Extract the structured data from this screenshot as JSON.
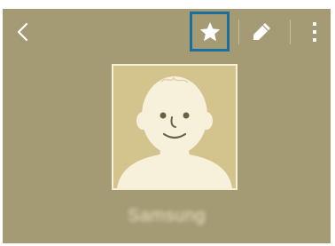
{
  "toolbar": {
    "back_icon": "chevron-left-icon",
    "favorite_icon": "star-icon",
    "edit_icon": "pencil-icon",
    "more_icon": "more-vertical-icon",
    "highlight_color": "#1a6f9e"
  },
  "contact": {
    "photo_icon": "default-avatar-icon",
    "name": "Samsung"
  },
  "colors": {
    "background": "#a49a73",
    "photo_background": "#d3c38c",
    "photo_border": "#f6efd8"
  }
}
